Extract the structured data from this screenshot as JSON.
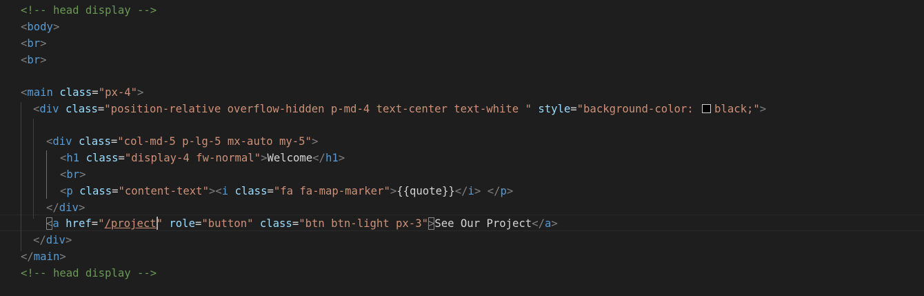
{
  "editor": {
    "comment_top": "<!-- head display -->",
    "comment_bottom": "<!-- head display -->",
    "body_tag": "body",
    "br_tag": "br",
    "main": {
      "tag": "main",
      "attr": "class",
      "value": "\"px-4\""
    },
    "outer_div": {
      "tag": "div",
      "class_attr": "class",
      "class_value": "\"position-relative overflow-hidden p-md-4 text-center text-white \"",
      "style_attr": "style",
      "style_value_before": "\"background-color: ",
      "style_value_after": "black;\"",
      "swatch_color": "#000000"
    },
    "inner_div": {
      "tag": "div",
      "attr": "class",
      "value": "\"col-md-5 p-lg-5 mx-auto my-5\""
    },
    "h1": {
      "tag": "h1",
      "attr": "class",
      "value": "\"display-4 fw-normal\"",
      "text": "Welcome"
    },
    "p": {
      "tag": "p",
      "attr": "class",
      "value": "\"content-text\"",
      "i_tag": "i",
      "i_attr": "class",
      "i_value": "\"fa fa-map-marker\"",
      "i_text": "{{quote}}"
    },
    "anchor": {
      "tag": "a",
      "href_attr": "href",
      "href_quote": "\"",
      "href_value": "/project",
      "href_close": "\"",
      "role_attr": "role",
      "role_value": "\"button\"",
      "class_attr": "class",
      "class_value": "\"btn btn-light px-3\"",
      "text": "See Our Project"
    },
    "div_tag": "div",
    "main_tag": "main"
  }
}
